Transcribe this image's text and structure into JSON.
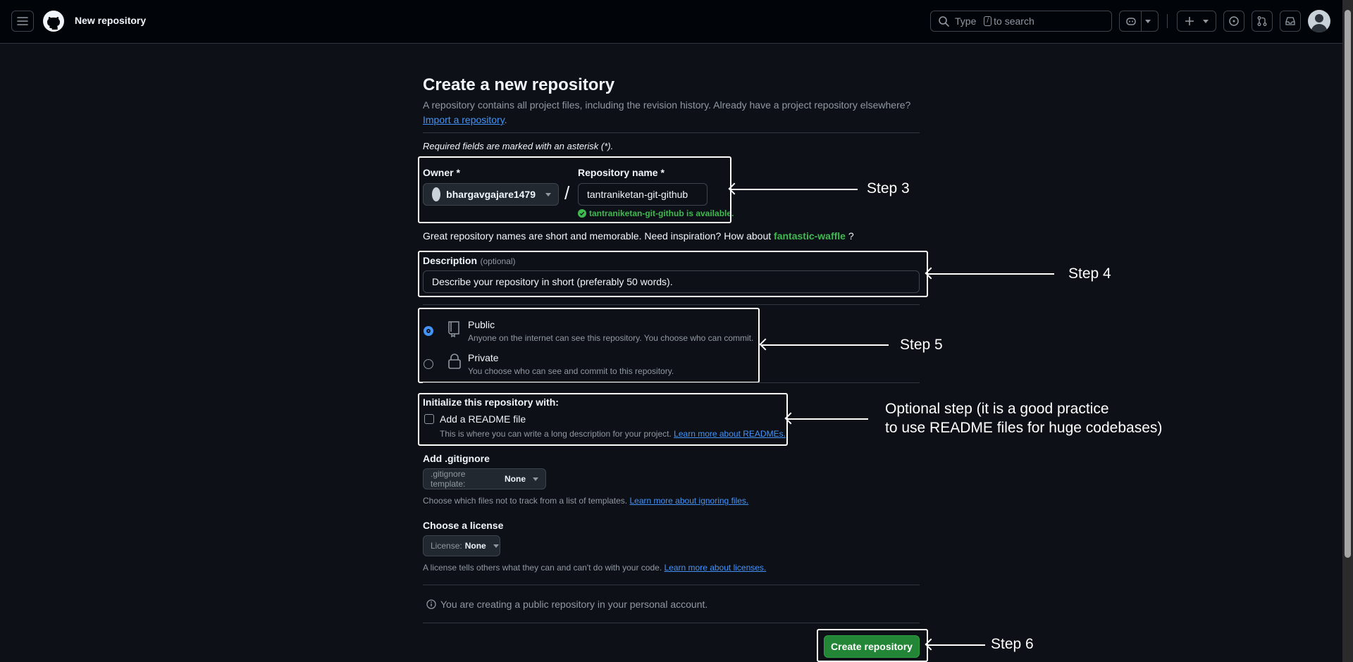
{
  "header": {
    "title": "New repository",
    "search_prefix": "Type",
    "search_key": "/",
    "search_suffix": "to search"
  },
  "page": {
    "heading": "Create a new repository",
    "subtitle": "A repository contains all project files, including the revision history. Already have a project repository elsewhere?",
    "import_link": "Import a repository",
    "required_note": "Required fields are marked with an asterisk (*)."
  },
  "owner": {
    "label": "Owner *",
    "value": "bhargavgajare1479"
  },
  "slash": "/",
  "repo": {
    "label": "Repository name *",
    "value": "tantraniketan-git-github",
    "availability": "tantraniketan-git-github is available."
  },
  "suggestion": {
    "text": "Great repository names are short and memorable. Need inspiration? How about",
    "name": "fantastic-waffle",
    "end": "?"
  },
  "description": {
    "label": "Description",
    "optional": "(optional)",
    "value": "Describe your repository in short (preferably 50 words)."
  },
  "visibility": {
    "public_title": "Public",
    "public_desc": "Anyone on the internet can see this repository. You choose who can commit.",
    "private_title": "Private",
    "private_desc": "You choose who can see and commit to this repository.",
    "selected": "Public"
  },
  "init": {
    "heading": "Initialize this repository with:",
    "readme_label": "Add a README file",
    "readme_desc": "This is where you can write a long description for your project.",
    "readme_link": "Learn more about READMEs.",
    "readme_checked": false
  },
  "gitignore": {
    "heading": "Add .gitignore",
    "select_prefix": ".gitignore template:",
    "select_value": "None",
    "desc": "Choose which files not to track from a list of templates.",
    "link": "Learn more about ignoring files."
  },
  "license": {
    "heading": "Choose a license",
    "select_prefix": "License:",
    "select_value": "None",
    "desc": "A license tells others what they can and can't do with your code.",
    "link": "Learn more about licenses."
  },
  "info_text": "You are creating a public repository in your personal account.",
  "create_button": "Create repository",
  "annotations": {
    "step3": "Step 3",
    "step4": "Step 4",
    "step5": "Step 5",
    "optional_line1": "Optional step (it is a good practice",
    "optional_line2": "to use README files for huge codebases)",
    "step6": "Step 6"
  },
  "colors": {
    "background": "#0d1117",
    "header": "#010409",
    "link": "#4493f8",
    "success": "#3fb950",
    "primary_button": "#238636",
    "annotation": "#ffffff"
  }
}
